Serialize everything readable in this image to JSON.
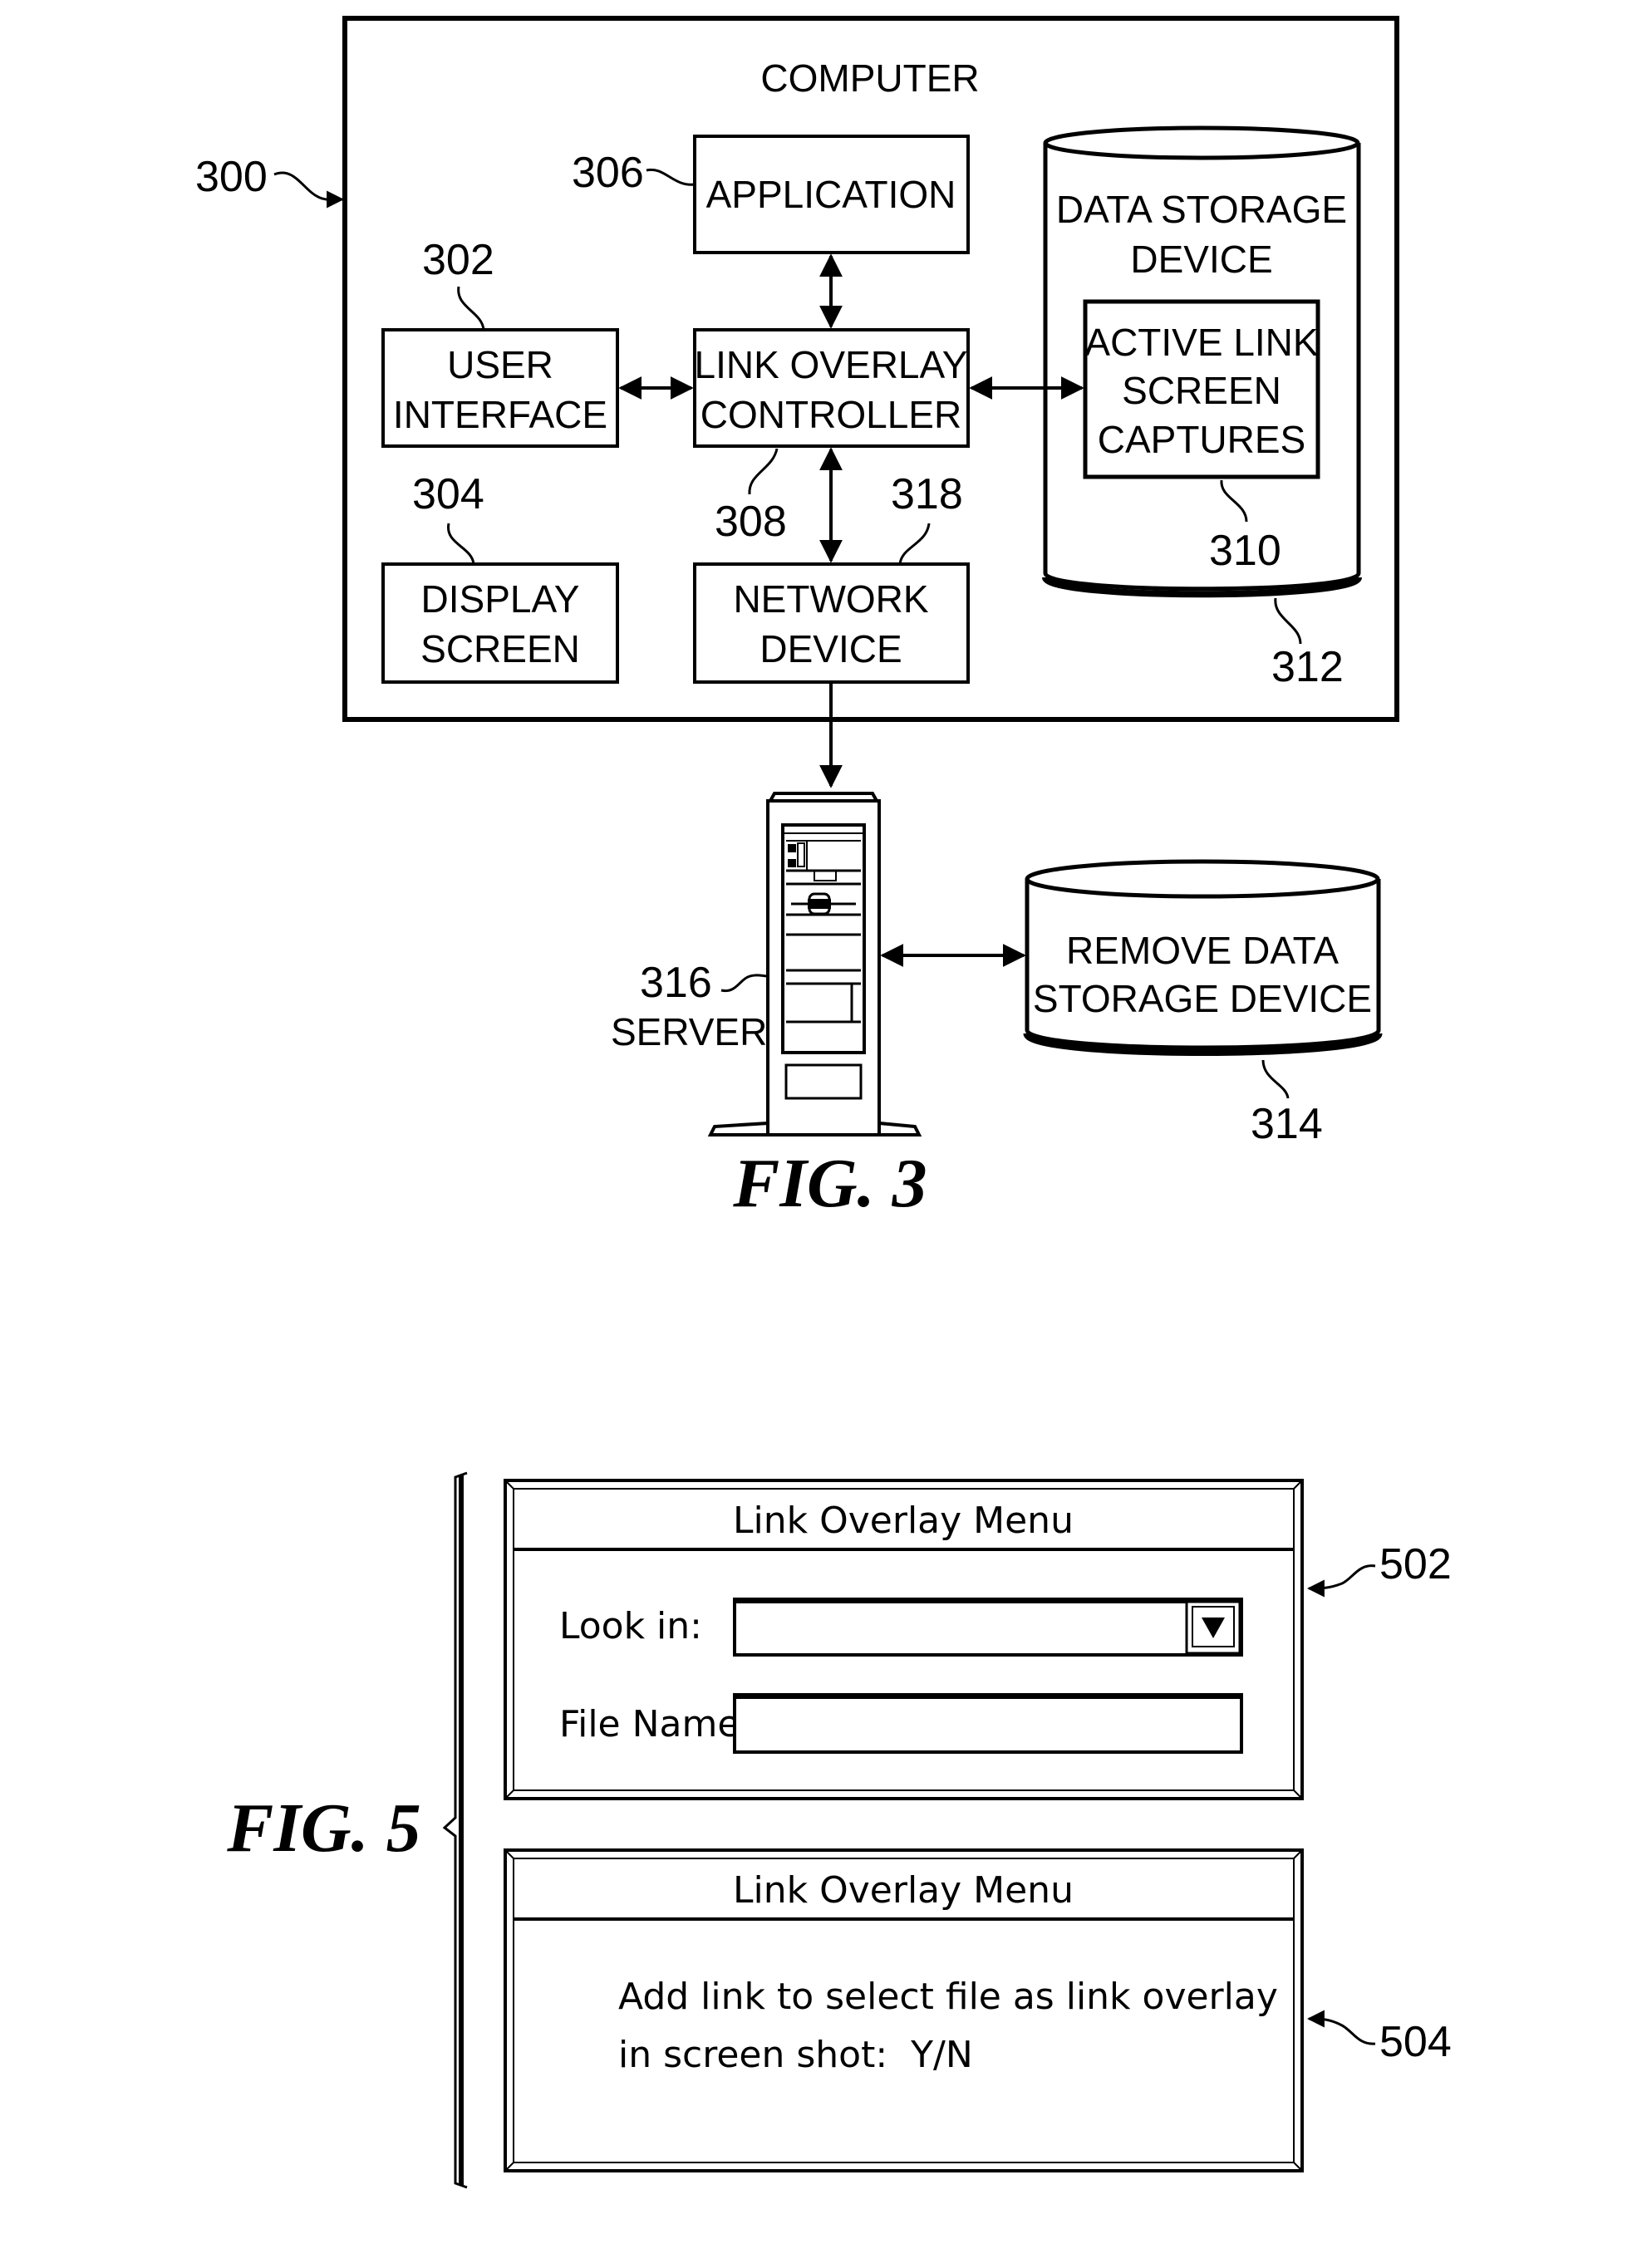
{
  "fig3": {
    "caption": "FIG. 3",
    "computer": {
      "label": "COMPUTER",
      "ref": "300"
    },
    "application": {
      "line1": "APPLICATION",
      "ref": "306"
    },
    "user_interface": {
      "line1": "USER",
      "line2": "INTERFACE",
      "ref": "302"
    },
    "link_overlay_controller": {
      "line1": "LINK OVERLAY",
      "line2": "CONTROLLER",
      "ref": "308"
    },
    "display_screen": {
      "line1": "DISPLAY",
      "line2": "SCREEN",
      "ref": "304"
    },
    "network_device": {
      "line1": "NETWORK",
      "line2": "DEVICE",
      "ref": "318"
    },
    "data_storage_device": {
      "line1": "DATA STORAGE",
      "line2": "DEVICE",
      "ref": "312"
    },
    "active_link_screen_captures": {
      "line1": "ACTIVE LINK",
      "line2": "SCREEN",
      "line3": "CAPTURES",
      "ref": "310"
    },
    "server": {
      "label": "SERVER",
      "ref": "316"
    },
    "remote_storage": {
      "line1": "REMOVE DATA",
      "line2": "STORAGE DEVICE",
      "ref": "314"
    }
  },
  "fig5": {
    "caption": "FIG. 5",
    "dialog_502": {
      "ref": "502",
      "title": "Link Overlay Menu",
      "look_in_label": "Look in:",
      "look_in_value": "",
      "dropdown_icon": "triangle-down",
      "file_name_label": "File Name:",
      "file_name_value": ""
    },
    "dialog_504": {
      "ref": "504",
      "title": "Link Overlay Menu",
      "line1": "Add link to select file as link overlay",
      "line2": "in screen shot:  Y/N"
    }
  }
}
